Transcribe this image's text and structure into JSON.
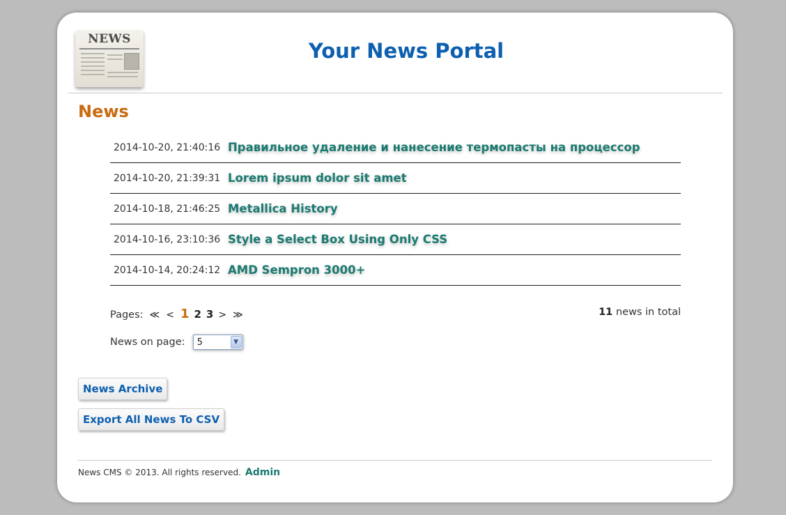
{
  "header": {
    "logo_text": "NEWS",
    "site_title": "Your News Portal"
  },
  "section_title": "News",
  "news": [
    {
      "date": "2014-10-20, 21:40:16",
      "title": "Правильное удаление и нанесение термопасты на процессор"
    },
    {
      "date": "2014-10-20, 21:39:31",
      "title": "Lorem ipsum dolor sit amet"
    },
    {
      "date": "2014-10-18, 21:46:25",
      "title": "Metallica History"
    },
    {
      "date": "2014-10-16, 23:10:36",
      "title": "Style a Select Box Using Only CSS"
    },
    {
      "date": "2014-10-14, 20:24:12",
      "title": "AMD Sempron 3000+"
    }
  ],
  "pagination": {
    "label": "Pages:",
    "first": "≪",
    "prev": "<",
    "pages": [
      "1",
      "2",
      "3"
    ],
    "current": "1",
    "next": ">",
    "last": "≫",
    "total_count": "11",
    "total_suffix": "news in total"
  },
  "per_page": {
    "label": "News on page:",
    "value": "5"
  },
  "buttons": {
    "archive": "News Archive",
    "export_csv": "Export All News To CSV"
  },
  "footer": {
    "copyright": "News CMS © 2013. All rights reserved.",
    "admin_link": "Admin"
  },
  "colors": {
    "site_title": "#0d5fb0",
    "section_title": "#c96a10",
    "news_link": "#1a7a70",
    "background": "#bcbcbc"
  }
}
